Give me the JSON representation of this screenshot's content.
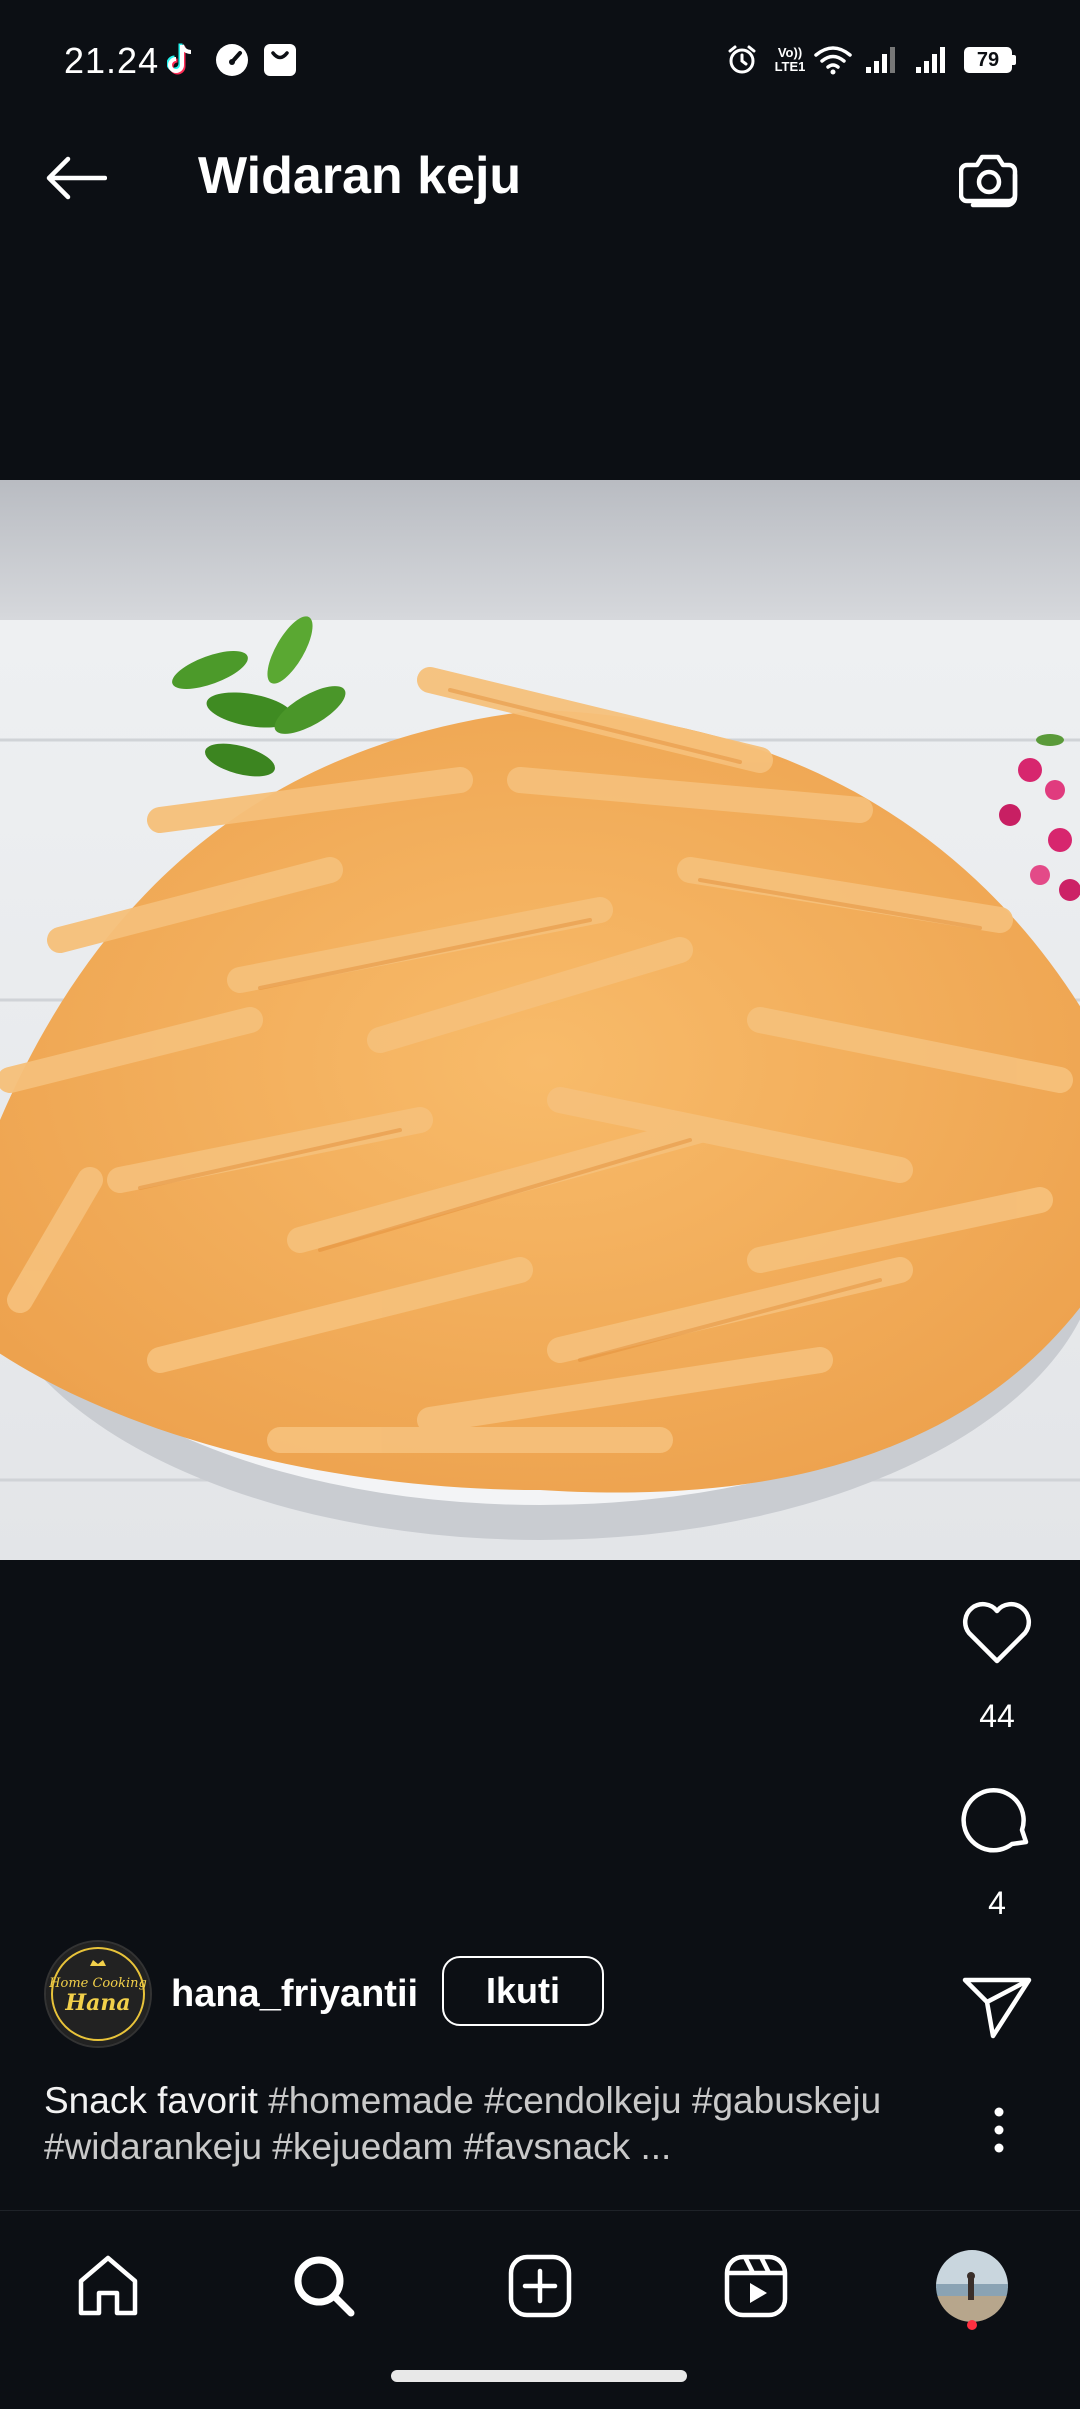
{
  "status_bar": {
    "time": "21.24",
    "network_label": "LTE1",
    "volte_label": "Vo))",
    "battery_level": "79"
  },
  "header": {
    "title": "Widaran keju"
  },
  "post": {
    "likes": "44",
    "comments": "4",
    "author": {
      "username": "hana_friyantii",
      "avatar_text_line1": "Home Cooking",
      "avatar_text_line2": "Hana"
    },
    "follow_label": "Ikuti",
    "caption_text": "Snack favorit",
    "caption_tags_line1": " #homemade #cendolkeju #gabuskeju",
    "caption_tags_line2": "#widarankeju #kejuedam #favsnack ..."
  },
  "colors": {
    "background": "#0c0f14",
    "text": "#ffffff",
    "notification_dot": "#ff3040"
  },
  "icons": {
    "back": "arrow-left-icon",
    "camera": "camera-icon",
    "like": "heart-icon",
    "comment": "comment-icon",
    "share": "send-icon",
    "more": "more-vertical-icon",
    "nav": [
      "home-icon",
      "search-icon",
      "add-icon",
      "reels-icon",
      "profile-avatar"
    ]
  }
}
